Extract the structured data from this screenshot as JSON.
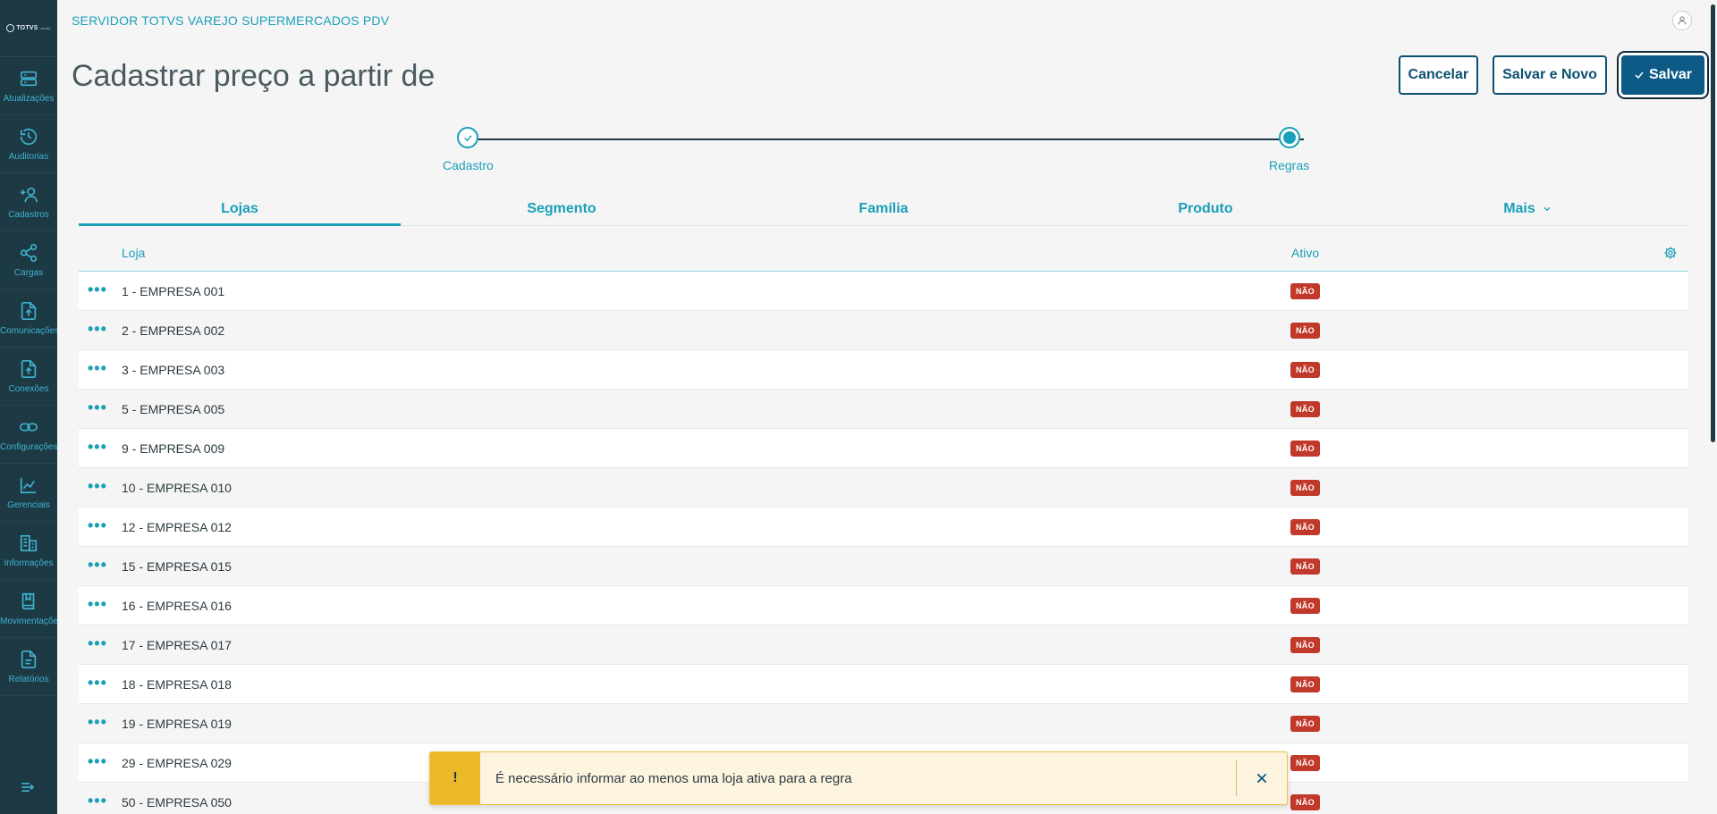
{
  "app": {
    "title": "SERVIDOR TOTVS VAREJO SUPERMERCADOS PDV",
    "logo_text": "TOTVS",
    "logo_sub": "varejo"
  },
  "sidebar": {
    "items": [
      {
        "label": "Atualizações",
        "icon": "server-icon"
      },
      {
        "label": "Auditorias",
        "icon": "history-icon"
      },
      {
        "label": "Cadastros",
        "icon": "add-user-icon"
      },
      {
        "label": "Cargas",
        "icon": "share-icon"
      },
      {
        "label": "Comunicações",
        "icon": "upload-file-icon"
      },
      {
        "label": "Conexões",
        "icon": "upload-file-icon"
      },
      {
        "label": "Configurações",
        "icon": "link-icon"
      },
      {
        "label": "Gerenciais",
        "icon": "chart-icon"
      },
      {
        "label": "Informações",
        "icon": "building-icon"
      },
      {
        "label": "Movimentações",
        "icon": "book-icon"
      },
      {
        "label": "Relatórios",
        "icon": "document-icon"
      }
    ]
  },
  "page": {
    "title": "Cadastrar preço a partir de"
  },
  "actions": {
    "cancel": "Cancelar",
    "save_new": "Salvar e Novo",
    "save": "Salvar"
  },
  "stepper": {
    "steps": [
      {
        "label": "Cadastro",
        "status": "done"
      },
      {
        "label": "Regras",
        "status": "current"
      }
    ]
  },
  "tabs": [
    {
      "label": "Lojas",
      "active": true
    },
    {
      "label": "Segmento",
      "active": false
    },
    {
      "label": "Família",
      "active": false
    },
    {
      "label": "Produto",
      "active": false
    },
    {
      "label": "Mais",
      "active": false
    }
  ],
  "table": {
    "columns": {
      "loja": "Loja",
      "ativo": "Ativo"
    },
    "rows": [
      {
        "loja": "1 - EMPRESA 001",
        "ativo": "NÃO"
      },
      {
        "loja": "2 - EMPRESA 002",
        "ativo": "NÃO"
      },
      {
        "loja": "3 - EMPRESA 003",
        "ativo": "NÃO"
      },
      {
        "loja": "5 - EMPRESA 005",
        "ativo": "NÃO"
      },
      {
        "loja": "9 - EMPRESA 009",
        "ativo": "NÃO"
      },
      {
        "loja": "10 - EMPRESA 010",
        "ativo": "NÃO"
      },
      {
        "loja": "12 - EMPRESA 012",
        "ativo": "NÃO"
      },
      {
        "loja": "15 - EMPRESA 015",
        "ativo": "NÃO"
      },
      {
        "loja": "16 - EMPRESA 016",
        "ativo": "NÃO"
      },
      {
        "loja": "17 - EMPRESA 017",
        "ativo": "NÃO"
      },
      {
        "loja": "18 - EMPRESA 018",
        "ativo": "NÃO"
      },
      {
        "loja": "19 - EMPRESA 019",
        "ativo": "NÃO"
      },
      {
        "loja": "29 - EMPRESA 029",
        "ativo": "NÃO"
      },
      {
        "loja": "50 - EMPRESA 050",
        "ativo": "NÃO"
      }
    ]
  },
  "toast": {
    "icon": "!",
    "message": "É necessário informar ao menos uma loja ativa para a regra"
  },
  "colors": {
    "sidebar_bg": "#1d3a44",
    "accent": "#1a9fb8",
    "primary_button": "#0c5a85",
    "badge_no": "#c0392b",
    "warning": "#ecb92a"
  }
}
